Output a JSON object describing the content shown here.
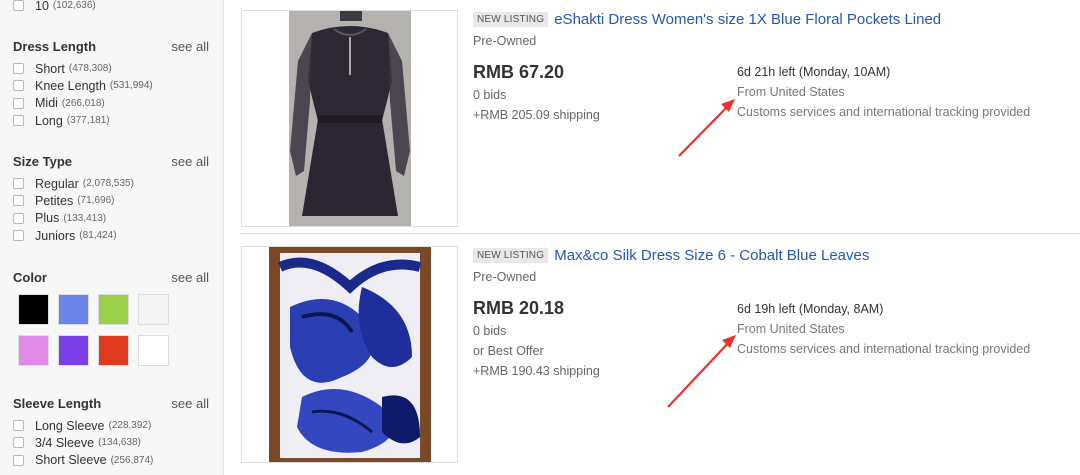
{
  "filters": {
    "size_row": {
      "label": "10",
      "count": "(102,636)"
    },
    "see_all": "see all",
    "dress_length": {
      "title": "Dress Length",
      "options": [
        {
          "label": "Short",
          "count": "(478,308)"
        },
        {
          "label": "Knee Length",
          "count": "(531,994)"
        },
        {
          "label": "Midi",
          "count": "(266,018)"
        },
        {
          "label": "Long",
          "count": "(377,181)"
        }
      ]
    },
    "size_type": {
      "title": "Size Type",
      "options": [
        {
          "label": "Regular",
          "count": "(2,078,535)"
        },
        {
          "label": "Petites",
          "count": "(71,696)"
        },
        {
          "label": "Plus",
          "count": "(133,413)"
        },
        {
          "label": "Juniors",
          "count": "(81,424)"
        }
      ]
    },
    "color": {
      "title": "Color",
      "swatches": [
        "#000000",
        "#6b84ea",
        "#9bd04a",
        "#f5f5f5",
        "#e08ae8",
        "#7a3fe6",
        "#e03a1f",
        "#ffffff"
      ]
    },
    "sleeve_length": {
      "title": "Sleeve Length",
      "options": [
        {
          "label": "Long Sleeve",
          "count": "(228,392)"
        },
        {
          "label": "3/4 Sleeve",
          "count": "(134,638)"
        },
        {
          "label": "Short Sleeve",
          "count": "(256,874)"
        }
      ]
    }
  },
  "listings": [
    {
      "badge": "NEW LISTING",
      "title": "eShakti Dress Women's size 1X Blue Floral Pockets Lined",
      "condition": "Pre-Owned",
      "price": "RMB 67.20",
      "bids": "0 bids",
      "shipping": "+RMB 205.09 shipping",
      "time_left": "6d 21h left (Monday, 10AM)",
      "location": "From United States",
      "customs": "Customs services and international tracking provided"
    },
    {
      "badge": "NEW LISTING",
      "title": "Max&co Silk Dress Size 6 - Cobalt Blue Leaves",
      "condition": "Pre-Owned",
      "price": "RMB 20.18",
      "bids": "0 bids",
      "best_offer": "or Best Offer",
      "shipping": "+RMB 190.43 shipping",
      "time_left": "6d 19h left (Monday, 8AM)",
      "location": "From United States",
      "customs": "Customs services and international tracking provided"
    }
  ],
  "annotation_color": "#e8332a"
}
